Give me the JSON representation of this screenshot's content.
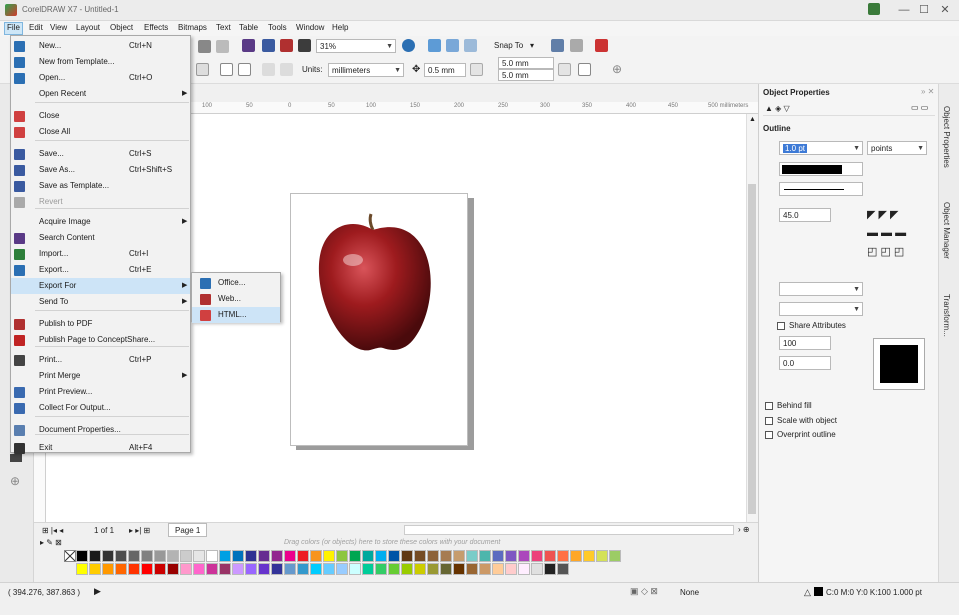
{
  "window": {
    "title": "CorelDRAW X7 - Untitled-1",
    "controls": [
      "minimize-icon",
      "maximize-icon",
      "close-icon"
    ]
  },
  "menubar": {
    "items": [
      "File",
      "Edit",
      "View",
      "Layout",
      "Object",
      "Effects",
      "Bitmaps",
      "Text",
      "Table",
      "Tools",
      "Window",
      "Help"
    ],
    "active": "File"
  },
  "toolbar": {
    "zoom": "31%",
    "snap_to": "Snap To",
    "units_label": "Units:",
    "units_value": "millimeters",
    "nudge": "0.5 mm",
    "dup_x": "5.0 mm",
    "dup_y": "5.0 mm"
  },
  "ruler": {
    "ticks": [
      "100",
      "50",
      "0",
      "50",
      "100",
      "150",
      "200",
      "250",
      "300",
      "350",
      "400",
      "450",
      "500 millimeters"
    ]
  },
  "file_menu": {
    "items": [
      {
        "label": "New...",
        "shortcut": "Ctrl+N",
        "icon": "new-document-icon"
      },
      {
        "label": "New from Template...",
        "shortcut": "",
        "icon": "template-icon"
      },
      {
        "label": "Open...",
        "shortcut": "Ctrl+O",
        "icon": "open-folder-icon"
      },
      {
        "label": "Open Recent",
        "shortcut": "",
        "icon": "",
        "submenu": true
      },
      {
        "label": "Close",
        "shortcut": "",
        "icon": "close-document-icon"
      },
      {
        "label": "Close All",
        "shortcut": "",
        "icon": "close-all-icon"
      },
      {
        "label": "Save...",
        "shortcut": "Ctrl+S",
        "icon": "save-icon"
      },
      {
        "label": "Save As...",
        "shortcut": "Ctrl+Shift+S",
        "icon": "save-as-icon"
      },
      {
        "label": "Save as Template...",
        "shortcut": "",
        "icon": "save-template-icon"
      },
      {
        "label": "Revert",
        "shortcut": "",
        "icon": "revert-icon",
        "disabled": true
      },
      {
        "label": "Acquire Image",
        "shortcut": "",
        "icon": "",
        "submenu": true
      },
      {
        "label": "Search Content",
        "shortcut": "",
        "icon": "search-content-icon"
      },
      {
        "label": "Import...",
        "shortcut": "Ctrl+I",
        "icon": "import-icon"
      },
      {
        "label": "Export...",
        "shortcut": "Ctrl+E",
        "icon": "export-icon"
      },
      {
        "label": "Export For",
        "shortcut": "",
        "icon": "",
        "submenu": true,
        "highlighted": true
      },
      {
        "label": "Send To",
        "shortcut": "",
        "icon": "",
        "submenu": true
      },
      {
        "label": "Publish to PDF",
        "shortcut": "",
        "icon": "pdf-icon"
      },
      {
        "label": "Publish Page to ConceptShare...",
        "shortcut": "",
        "icon": "conceptshare-icon"
      },
      {
        "label": "Print...",
        "shortcut": "Ctrl+P",
        "icon": "print-icon"
      },
      {
        "label": "Print Merge",
        "shortcut": "",
        "icon": "",
        "submenu": true
      },
      {
        "label": "Print Preview...",
        "shortcut": "",
        "icon": "print-preview-icon"
      },
      {
        "label": "Collect For Output...",
        "shortcut": "",
        "icon": "collect-output-icon"
      },
      {
        "label": "Document Properties...",
        "shortcut": "",
        "icon": "document-properties-icon"
      },
      {
        "label": "Exit",
        "shortcut": "Alt+F4",
        "icon": "exit-icon"
      }
    ]
  },
  "export_for_submenu": {
    "items": [
      {
        "label": "Office...",
        "icon": "office-icon"
      },
      {
        "label": "Web...",
        "icon": "web-icon"
      },
      {
        "label": "HTML...",
        "icon": "html-icon",
        "highlighted": true
      }
    ]
  },
  "page_nav": {
    "counter": "1 of 1",
    "page_tab": "Page 1"
  },
  "palette": {
    "hint": "Drag colors (or objects) here to store these colors with your document"
  },
  "object_properties": {
    "title": "Object Properties",
    "section": "Outline",
    "width": "1.0 pt",
    "width_units": "points",
    "angle": "45.0",
    "share_attributes": "Share Attributes",
    "stretch": "100",
    "slant": "0.0",
    "behind_fill": "Behind fill",
    "scale_with_object": "Scale with object",
    "overprint_outline": "Overprint outline"
  },
  "docker_tabs": [
    "Object Properties",
    "Object Manager",
    "Transform..."
  ],
  "status": {
    "coords": "( 394.276, 387.863 )",
    "fill_label": "None",
    "outline_info": "C:0 M:0 Y:0 K:100  1.000 pt"
  },
  "colors": {
    "menu_highlight": "#cde4f7",
    "apple_red": "#9e1b1e"
  }
}
